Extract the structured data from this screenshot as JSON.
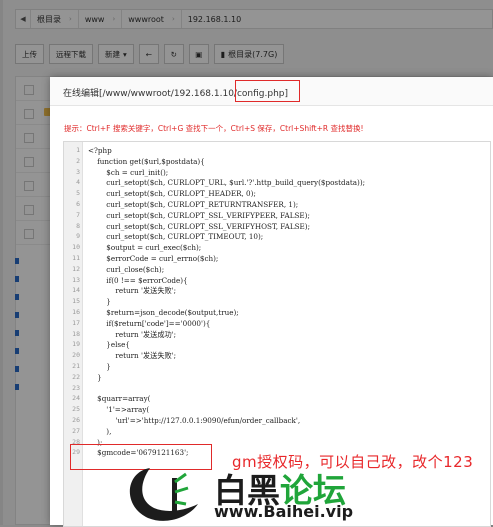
{
  "breadcrumb": {
    "segments": [
      "根目录",
      "www",
      "wwwroot",
      "192.168.1.10"
    ]
  },
  "toolbar": {
    "upload": "上传",
    "remote_download": "远程下载",
    "new": "新建",
    "root_dir": "根目录(7.7G)"
  },
  "modal": {
    "title": "在线编辑[/www/wwwroot/192.168.1.10/config.php]",
    "tip": "提示：Ctrl+F 搜索关键字，Ctrl+G 查找下一个，Ctrl+S 保存，Ctrl+Shift+R 查找替换!"
  },
  "editor": {
    "line_numbers": [
      "1",
      "2",
      "3",
      "4",
      "5",
      "6",
      "7",
      "8",
      "9",
      "10",
      "11",
      "12",
      "13",
      "14",
      "15",
      "16",
      "17",
      "18",
      "19",
      "20",
      "21",
      "22",
      "23",
      "24",
      "25",
      "26",
      "27",
      "28",
      "29"
    ],
    "lines": [
      "<?php",
      "    function get($url,$postdata){",
      "        $ch = curl_init();",
      "        curl_setopt($ch, CURLOPT_URL, $url.'?'.http_build_query($postdata));",
      "        curl_setopt($ch, CURLOPT_HEADER, 0);",
      "        curl_setopt($ch, CURLOPT_RETURNTRANSFER, 1);",
      "        curl_setopt($ch, CURLOPT_SSL_VERIFYPEER, FALSE);",
      "        curl_setopt($ch, CURLOPT_SSL_VERIFYHOST, FALSE);",
      "        curl_setopt($ch, CURLOPT_TIMEOUT, 10);",
      "        $output = curl_exec($ch);",
      "        $errorCode = curl_errno($ch);",
      "        curl_close($ch);",
      "        if(0 !== $errorCode){",
      "            return '发送失败';",
      "        }",
      "        $return=json_decode($output,true);",
      "        if($return['code']=='0000'){",
      "            return '发送成功';",
      "        }else{",
      "            return '发送失败';",
      "        }",
      "    }",
      "",
      "    $quarr=array(",
      "        '1'=>array(",
      "            'url'=>'http://127.0.0.1:9090/efun/order_callback',",
      "        ),",
      "    );",
      "    $gmcode='0679121163';"
    ]
  },
  "annotation": {
    "text": "gm授权码，可以自己改，改个123"
  },
  "watermark": {
    "brand_part1": "白黑",
    "brand_part2": "论坛",
    "url": "www.Baihei.vip"
  },
  "colors": {
    "accent": "#20a53a",
    "highlight_red": "#e02a2a",
    "watermark_red": "#e8282b"
  }
}
